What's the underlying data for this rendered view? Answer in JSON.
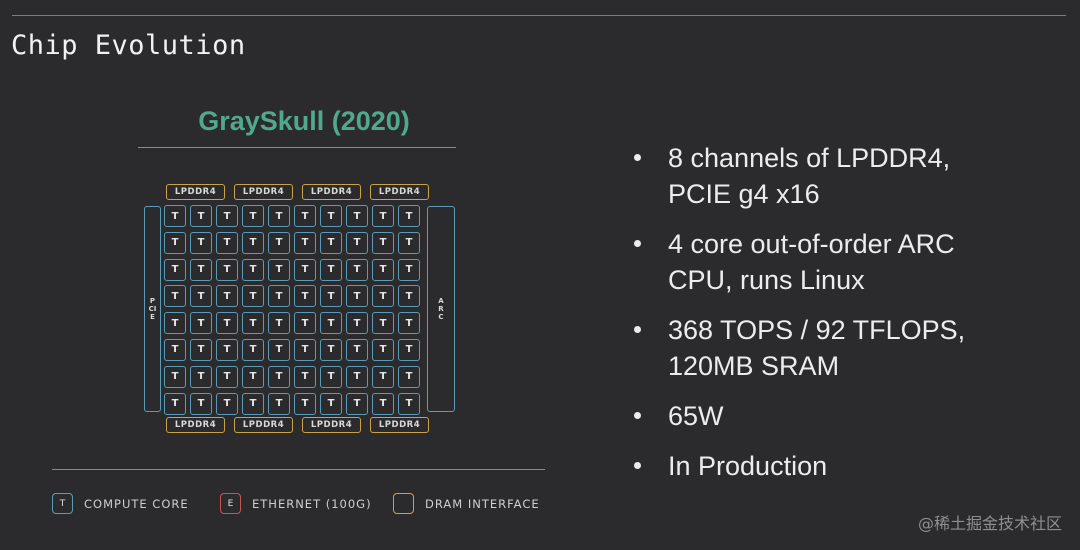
{
  "slide": {
    "title": "Chip Evolution"
  },
  "chip": {
    "name": "GraySkull (2020)",
    "title_color": "#4fa98a",
    "dram_labels_top": [
      "LPDDR4",
      "LPDDR4",
      "LPDDR4",
      "LPDDR4"
    ],
    "dram_labels_bottom": [
      "LPDDR4",
      "LPDDR4",
      "LPDDR4",
      "LPDDR4"
    ],
    "left_interface": "PCIE",
    "right_interface": "ARC",
    "core_rows": 8,
    "core_cols": 10,
    "core_label": "T",
    "core_color": "#5a9cb8",
    "dram_color": "#c9a24a"
  },
  "legend": [
    {
      "symbol": "T",
      "label": "COMPUTE CORE",
      "color": "#5a9cb8"
    },
    {
      "symbol": "E",
      "label": "ETHERNET (100G)",
      "color": "#c4574e"
    },
    {
      "symbol": "",
      "label": "DRAM INTERFACE",
      "color": "#c9a24a"
    }
  ],
  "bullets": [
    "8 channels of LPDDR4, PCIE g4 x16",
    "4 core out-of-order ARC CPU, runs Linux",
    "368 TOPS / 92 TFLOPS, 120MB SRAM",
    "65W",
    "In Production"
  ],
  "watermark": "@稀土掘金技术社区"
}
